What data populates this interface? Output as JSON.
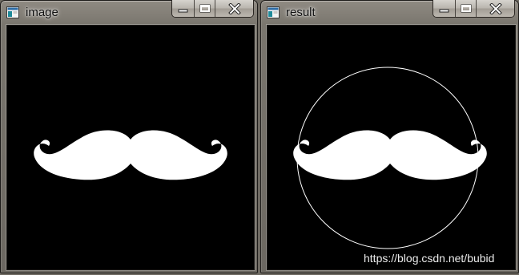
{
  "windows": [
    {
      "title": "image",
      "buttons": {
        "minimize": "minimize-icon",
        "maximize": "maximize-icon",
        "close": "close-icon"
      }
    },
    {
      "title": "result",
      "buttons": {
        "minimize": "minimize-icon",
        "maximize": "maximize-icon",
        "close": "close-icon"
      }
    }
  ],
  "watermark": "https://blog.csdn.net/bubid",
  "colors": {
    "canvas_background": "#000000",
    "shape_fill": "#ffffff",
    "circle_stroke": "#ffffff"
  },
  "icons": [
    "app-window-icon",
    "minimize-icon",
    "maximize-icon",
    "close-icon",
    "mustache-shape",
    "enclosing-circle"
  ]
}
